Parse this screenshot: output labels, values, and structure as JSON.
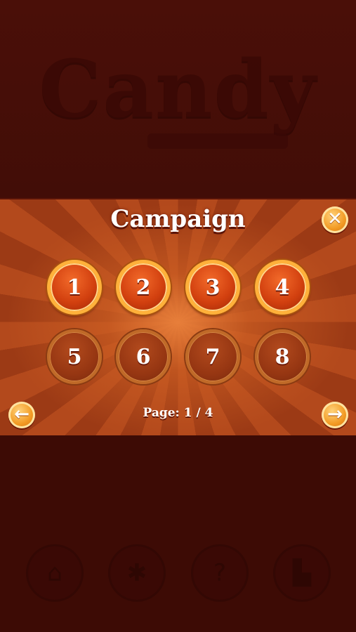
{
  "background": {
    "logo_text": "Candy",
    "menu_buttons": [
      {
        "icon": "home-icon",
        "glyph": "⌂"
      },
      {
        "icon": "settings-gear-icon",
        "glyph": "✱"
      },
      {
        "icon": "help-question-icon",
        "glyph": "?"
      },
      {
        "icon": "leaderboard-icon",
        "glyph": "▙"
      }
    ]
  },
  "dialog": {
    "title": "Campaign",
    "close_glyph": "✕",
    "levels": [
      {
        "number": "1",
        "unlocked": true
      },
      {
        "number": "2",
        "unlocked": true
      },
      {
        "number": "3",
        "unlocked": true
      },
      {
        "number": "4",
        "unlocked": true
      },
      {
        "number": "5",
        "unlocked": false
      },
      {
        "number": "6",
        "unlocked": false
      },
      {
        "number": "7",
        "unlocked": false
      },
      {
        "number": "8",
        "unlocked": false
      }
    ],
    "prev_glyph": "←",
    "next_glyph": "→",
    "page_label": "Page: 1 / 4"
  },
  "colors": {
    "button_orange": "#f29a23",
    "level_unlocked_fill": "#d2400f",
    "level_ring": "#ffb13a",
    "background_dark": "#3f0c06"
  }
}
